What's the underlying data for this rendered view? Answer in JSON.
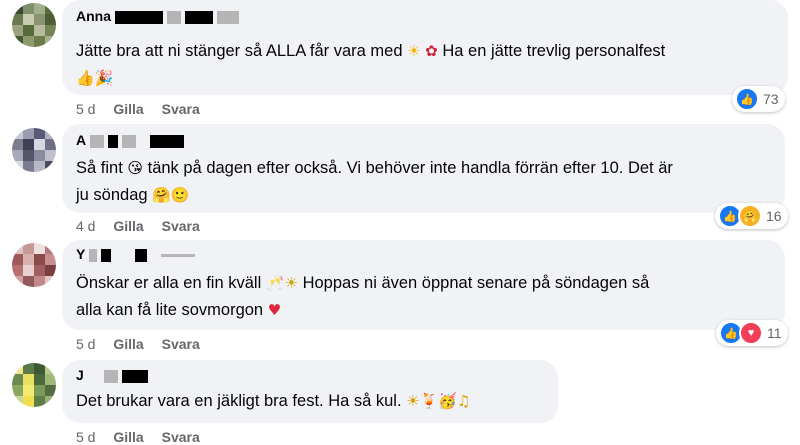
{
  "comments": [
    {
      "name": "Anna",
      "text_line1": "Jätte bra att ni stänger så ALLA får vara med",
      "text_line1_tail": "Ha en jätte trevlig personalfest",
      "emoji_a": "☀",
      "emoji_b": "✿",
      "text_line2_emoji": "👍🎉",
      "time": "5 d",
      "like": "Gilla",
      "reply": "Svara",
      "reaction_count": "73",
      "reaction_icons": [
        "like-icon"
      ]
    },
    {
      "name": "A",
      "text_line1": "Så fint",
      "emoji_kiss": "😘",
      "text_line1_tail": "tänk på dagen efter också. Vi behöver inte handla förrän efter 10. Det är",
      "text_line2": "ju söndag",
      "text_line2_emoji": "🤗🙂",
      "time": "4 d",
      "like": "Gilla",
      "reply": "Svara",
      "reaction_count": "16",
      "reaction_icons": [
        "like-icon",
        "care-icon"
      ]
    },
    {
      "name": "Y",
      "text_line1": "Önskar er alla en fin kväll",
      "emoji_a": "🥂☀",
      "text_line1_tail": "Hoppas ni även öppnat senare på söndagen så",
      "text_line2": "alla kan få lite sovmorgon",
      "text_line2_emoji": "♥",
      "time": "5 d",
      "like": "Gilla",
      "reply": "Svara",
      "reaction_count": "11",
      "reaction_icons": [
        "like-icon",
        "heart-icon"
      ]
    },
    {
      "name": "J",
      "text_line1": "Det brukar vara en jäkligt bra fest. Ha så kul.",
      "emoji_a": "☀🍹🥳♫",
      "time": "5 d",
      "like": "Gilla",
      "reply": "Svara"
    }
  ],
  "colors": {
    "bubble": "#f0f2f5",
    "meta": "#65676b",
    "like_blue": "#1877f2",
    "heart_red": "#f33e58"
  }
}
